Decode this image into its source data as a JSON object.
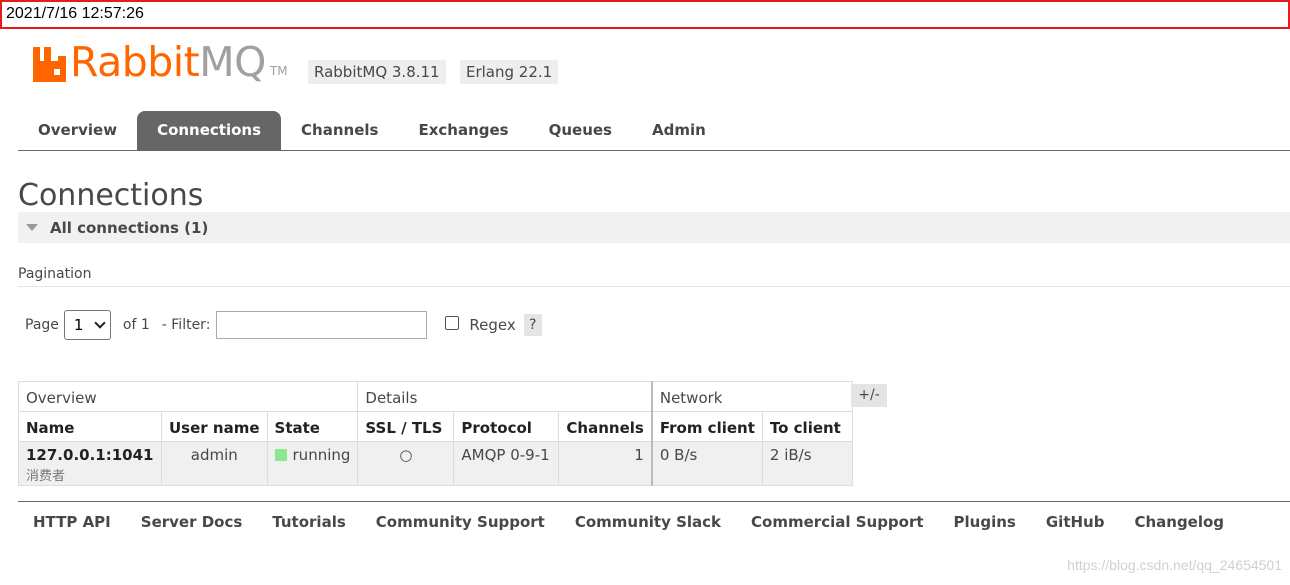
{
  "timestamp": "2021/7/16 12:57:26",
  "logo": {
    "word_rabbit": "Rabbit",
    "word_mq": "MQ",
    "tm": "TM",
    "accent": "#ff6600"
  },
  "versions": {
    "rabbitmq": "RabbitMQ 3.8.11",
    "erlang": "Erlang 22.1"
  },
  "tabs": [
    {
      "label": "Overview",
      "active": false
    },
    {
      "label": "Connections",
      "active": true
    },
    {
      "label": "Channels",
      "active": false
    },
    {
      "label": "Exchanges",
      "active": false
    },
    {
      "label": "Queues",
      "active": false
    },
    {
      "label": "Admin",
      "active": false
    }
  ],
  "page_title": "Connections",
  "section": {
    "label": "All connections (1)"
  },
  "pagination": {
    "label": "Pagination",
    "page_label": "Page",
    "page_value": "1",
    "of_label": "of 1",
    "filter_label": "- Filter:",
    "filter_value": "",
    "regex_label": "Regex",
    "help_label": "?"
  },
  "table": {
    "groups": [
      "Overview",
      "Details",
      "Network"
    ],
    "headers": [
      "Name",
      "User name",
      "State",
      "SSL / TLS",
      "Protocol",
      "Channels",
      "From client",
      "To client"
    ],
    "rows": [
      {
        "name": "127.0.0.1:1041",
        "name_sub": "消费者",
        "user": "admin",
        "state": "running",
        "ssl": "○",
        "protocol": "AMQP 0-9-1",
        "channels": "1",
        "from_client": "0 B/s",
        "to_client": "2 iB/s"
      }
    ],
    "columns_toggle": "+/-"
  },
  "footer": [
    "HTTP API",
    "Server Docs",
    "Tutorials",
    "Community Support",
    "Community Slack",
    "Commercial Support",
    "Plugins",
    "GitHub",
    "Changelog"
  ],
  "watermark": "https://blog.csdn.net/qq_24654501"
}
